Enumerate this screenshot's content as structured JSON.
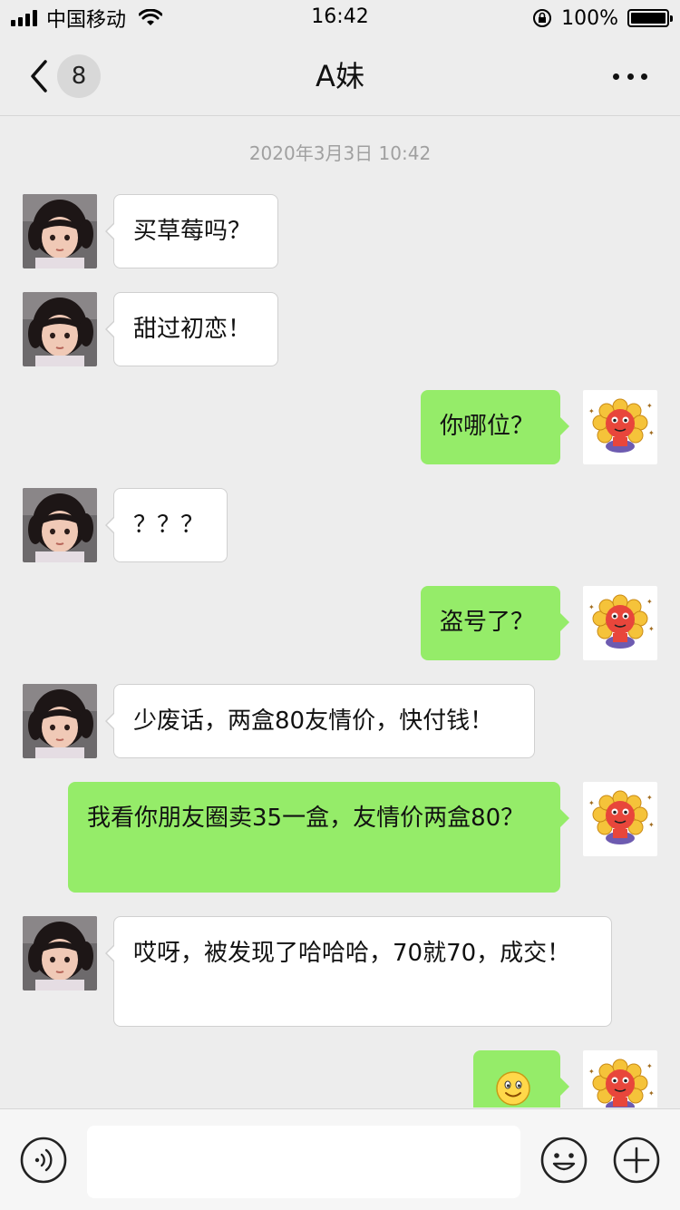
{
  "status_bar": {
    "carrier": "中国移动",
    "time": "16:42",
    "battery": "100%",
    "battery_level": 1.0
  },
  "nav": {
    "unread_count": "8",
    "title": "A妹"
  },
  "chat": {
    "timestamp": "2020年3月3日 10:42",
    "messages": [
      {
        "side": "in",
        "text": "买草莓吗？"
      },
      {
        "side": "in",
        "text": "甜过初恋！"
      },
      {
        "side": "out",
        "text": "你哪位？"
      },
      {
        "side": "in",
        "text": "？？？"
      },
      {
        "side": "out",
        "text": "盗号了？"
      },
      {
        "side": "in",
        "text": "少废话，两盒80友情价，快付钱！"
      },
      {
        "side": "out",
        "text": "我看你朋友圈卖35一盒，友情价两盒80？"
      },
      {
        "side": "in",
        "text": "哎呀，被发现了哈哈哈，70就70，成交！"
      },
      {
        "side": "out",
        "text": "",
        "emoji": "smile-emoji"
      }
    ]
  },
  "colors": {
    "outgoing_bubble": "#95ec69",
    "incoming_bubble": "#ffffff",
    "background": "#ededed"
  },
  "icons": {
    "back": "chevron-left-icon",
    "more": "more-dots-icon",
    "voice": "voice-icon",
    "emoji": "emoji-face-icon",
    "plus": "plus-icon"
  }
}
